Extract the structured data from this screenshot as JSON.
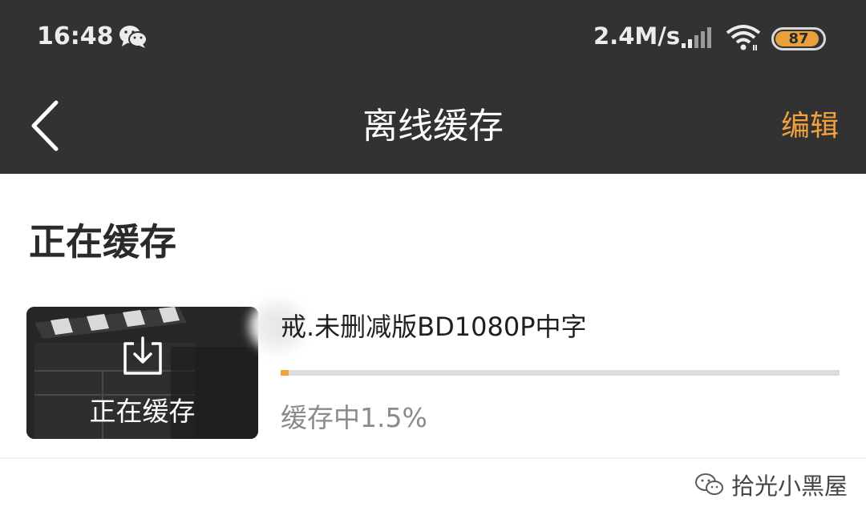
{
  "statusbar": {
    "time": "16:48",
    "network_speed": "2.4M/s",
    "battery_level": "87",
    "icons": [
      "wechat-icon",
      "signal-icon",
      "wifi-icon",
      "battery-icon"
    ]
  },
  "navbar": {
    "title": "离线缓存",
    "edit_label": "编辑",
    "back_icon": "chevron-left-icon"
  },
  "section": {
    "title": "正在缓存"
  },
  "downloads": [
    {
      "thumbnail_label": "正在缓存",
      "filename": "戒.未删减版BD1080P中字",
      "status_text": "缓存中1.5%",
      "progress": 0.015
    }
  ],
  "watermark": {
    "text": "拾光小黑屋"
  },
  "colors": {
    "accent": "#f3a13c",
    "bar_background": "#323232",
    "progress_track": "#dcdcdc"
  }
}
